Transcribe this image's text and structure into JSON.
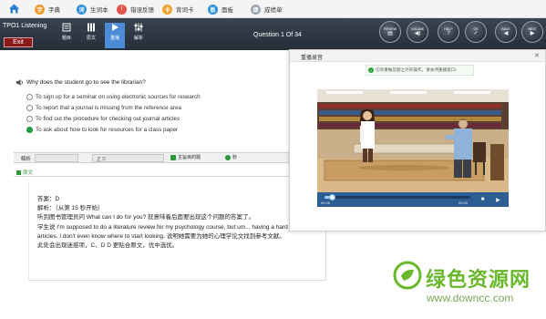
{
  "nav": {
    "items": [
      {
        "label": "字典",
        "icon": "dictionary-icon",
        "color": "#f29a2e"
      },
      {
        "label": "生词本",
        "icon": "vocabulary-book-icon",
        "color": "#2d8fd5"
      },
      {
        "label": "错误反馈",
        "icon": "feedback-icon",
        "color": "#e5534b"
      },
      {
        "label": "背词卡",
        "icon": "flashcard-icon",
        "color": "#f2a22e"
      },
      {
        "label": "面板",
        "icon": "panel-icon",
        "color": "#2d8fd5"
      },
      {
        "label": "成绩单",
        "icon": "report-card-icon",
        "color": "#9aa4b0"
      }
    ]
  },
  "toolbar": {
    "title": "TPO1  Listening",
    "exit_label": "Exit",
    "tools": [
      {
        "label": "题目",
        "icon": "question-icon"
      },
      {
        "label": "原文",
        "icon": "transcript-icon"
      },
      {
        "label": "重播",
        "icon": "replay-icon"
      },
      {
        "label": "解析",
        "icon": "analysis-icon"
      }
    ],
    "question_counter": "Question 1 Of  34",
    "buttons": [
      {
        "label": "REVIEW",
        "glyph": "▤",
        "icon": "review-icon"
      },
      {
        "label": "VOLUME",
        "glyph": "◀)",
        "icon": "volume-icon"
      },
      {
        "label": "HELP",
        "glyph": "?",
        "icon": "help-icon"
      },
      {
        "label": "OK",
        "glyph": "✓",
        "icon": "ok-icon"
      },
      {
        "label": "BACK",
        "glyph": "◀",
        "icon": "back-icon"
      },
      {
        "label": "NEXT",
        "glyph": "▶",
        "icon": "next-icon"
      }
    ]
  },
  "question": {
    "text": "Why does the student go to see the librarian?",
    "options": [
      {
        "text": "To sign up for a seminar on using electronic sources for research",
        "selected": false
      },
      {
        "text": "To report that a journal is missing from the reference area",
        "selected": false
      },
      {
        "text": "To find out the procedure for checking out journal articles",
        "selected": false
      },
      {
        "text": "To ask about how to look for resources for a class paper",
        "selected": true
      }
    ]
  },
  "analysis": {
    "label": "解析",
    "seg_text": "正 D",
    "topic_label": "主旨目的题",
    "speed_label": "秒",
    "tab_label": "原文",
    "lines": [
      "答案：D",
      "解析：（从第 15 秒开始）",
      "听到图书管理员问 What can I do for you? 就意味着后面要出现这个问题的答案了。",
      "学生说 I'm supposed to do a literature review for my psychology course, but um... having a hard tim",
      "articles. I don't even know where to start looking. 说明她需要为她的心理学论文找到参考文献。",
      "此处会出现迷惑项，C、D D 更贴合原文，优中选优。"
    ]
  },
  "video": {
    "title": "重播录音",
    "notice": "切勿重做答题之外的操作，请关闭重播窗口!",
    "time_current": "00:06",
    "time_total": "00:40",
    "progress": 0.05
  },
  "watermark": {
    "title": "绿色资源网",
    "url": "www.downcc.com"
  }
}
